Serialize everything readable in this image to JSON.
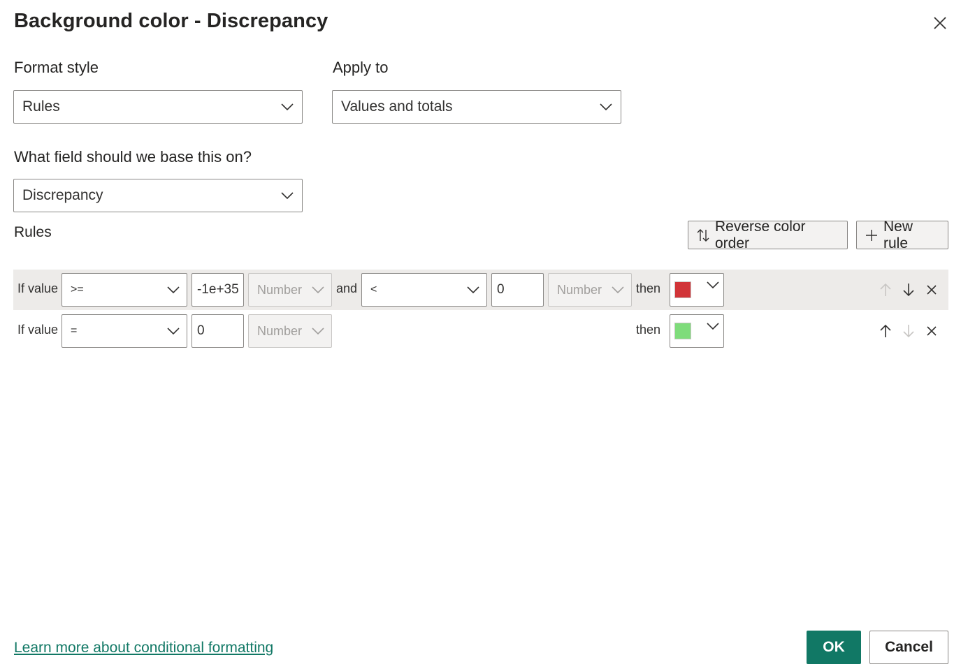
{
  "dialog": {
    "title": "Background color - Discrepancy",
    "close_icon": "close-icon"
  },
  "format_style": {
    "label": "Format style",
    "value": "Rules"
  },
  "apply_to": {
    "label": "Apply to",
    "value": "Values and totals"
  },
  "base_field": {
    "label": "What field should we base this on?",
    "value": "Discrepancy"
  },
  "rules_section": {
    "label": "Rules",
    "reverse_label": "Reverse color order",
    "reverse_icon": "sort-arrows-icon",
    "new_rule_label": "New rule",
    "new_rule_icon": "plus-icon"
  },
  "rules": [
    {
      "if_label": "If value",
      "op1": ">=",
      "value1": "-1e+35",
      "type1": "Number",
      "and_label": "and",
      "op2": "<",
      "value2": "0",
      "type2": "Number",
      "then_label": "then",
      "color": "#d13438",
      "up_enabled": false,
      "down_enabled": true
    },
    {
      "if_label": "If value",
      "op1": "=",
      "value1": "0",
      "type1": "Number",
      "then_label": "then",
      "color": "#7fdc7b",
      "up_enabled": true,
      "down_enabled": false
    }
  ],
  "footer": {
    "learn_more": "Learn more about conditional formatting",
    "ok_label": "OK",
    "cancel_label": "Cancel"
  },
  "colors": {
    "accent": "#117865",
    "row_selected": "#edebe9"
  }
}
